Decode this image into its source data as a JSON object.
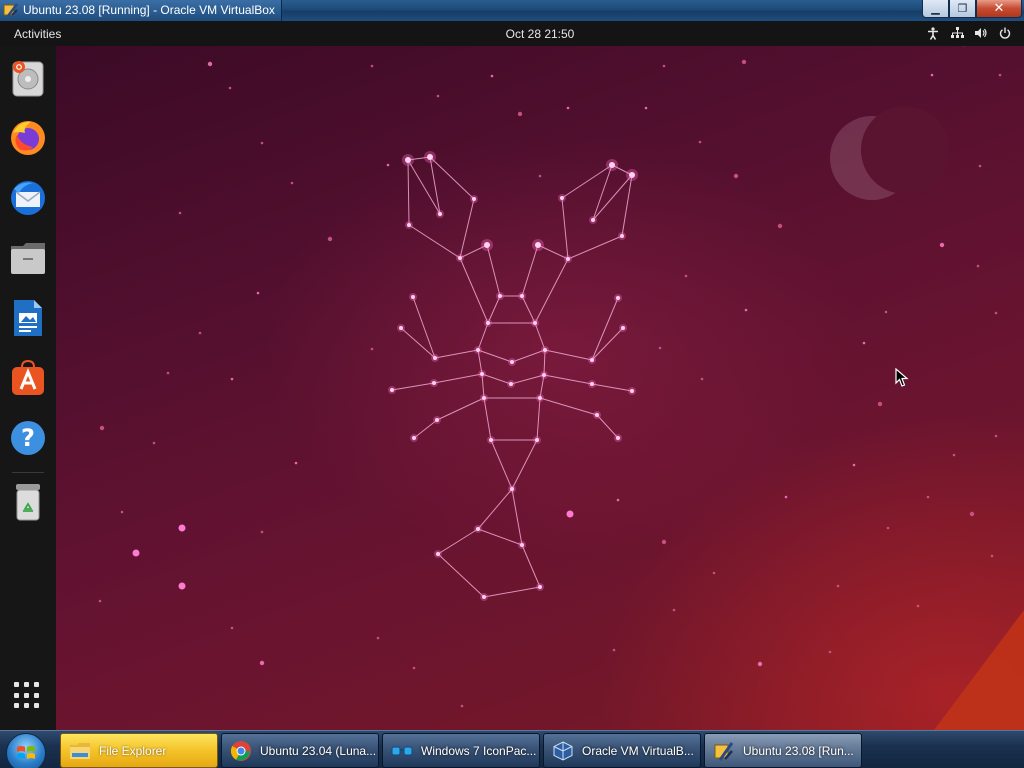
{
  "host_window": {
    "title": "Ubuntu 23.08 [Running] - Oracle VM VirtualBox",
    "icon": "virtualbox-icon",
    "controls": {
      "minimize": "▁",
      "restore": "❐",
      "close": "✕"
    }
  },
  "gnome": {
    "activities_label": "Activities",
    "clock": "Oct 28  21:50",
    "tray_icons": [
      "accessibility-icon",
      "network-icon",
      "volume-icon",
      "power-icon"
    ]
  },
  "dock": {
    "items": [
      {
        "name": "installer-icon",
        "tooltip": "Install Ubuntu"
      },
      {
        "name": "firefox-icon",
        "tooltip": "Firefox"
      },
      {
        "name": "thunderbird-icon",
        "tooltip": "Thunderbird"
      },
      {
        "name": "files-icon",
        "tooltip": "Files"
      },
      {
        "name": "libreoffice-writer-icon",
        "tooltip": "LibreOffice Writer"
      },
      {
        "name": "app-center-icon",
        "tooltip": "App Center"
      },
      {
        "name": "help-icon",
        "tooltip": "Help"
      },
      {
        "name": "trash-icon",
        "tooltip": "Trash"
      }
    ],
    "show_apps_icon": "grid-icon"
  },
  "taskbar": {
    "start_icon": "windows-start-orb",
    "buttons": [
      {
        "label": "File Explorer",
        "icon": "folder-icon",
        "state": "active"
      },
      {
        "label": "Ubuntu 23.04 (Luna...",
        "icon": "chrome-icon",
        "state": "normal"
      },
      {
        "label": "Windows 7 IconPac...",
        "icon": "glasses-icon",
        "state": "normal"
      },
      {
        "label": "Oracle VM VirtualB...",
        "icon": "virtualbox-cube-icon",
        "state": "normal"
      },
      {
        "label": "Ubuntu 23.08 [Run...",
        "icon": "virtualbox-icon",
        "state": "current"
      }
    ]
  },
  "colors": {
    "gnome_bar": "#141414",
    "wallpaper_dark": "#3a0a26",
    "wallpaper_mid": "#6a1430",
    "constellation": "#ff6ac8",
    "taskbar_active": "#f4c32a"
  }
}
